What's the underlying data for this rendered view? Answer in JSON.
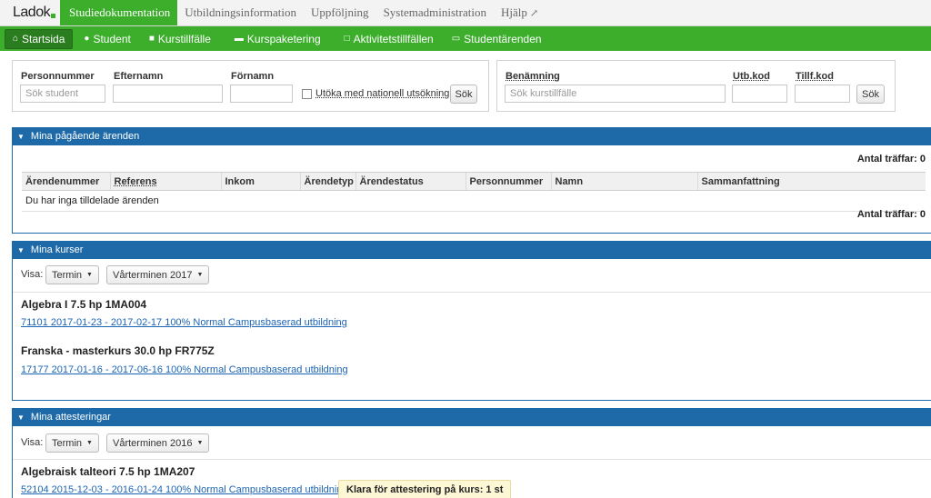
{
  "brand": {
    "logo": "Ladok",
    "accent": "#3cae2c",
    "section_blue": "#1e6aa8"
  },
  "topnav": {
    "tabs": [
      {
        "label": "Studiedokumentation"
      },
      {
        "label": "Utbildningsinformation"
      },
      {
        "label": "Uppföljning"
      },
      {
        "label": "Systemadministration"
      },
      {
        "label": "Hjälp",
        "icon": "external-link-icon"
      }
    ]
  },
  "subnav": {
    "items": [
      {
        "label": "Startsida",
        "icon": "home-icon"
      },
      {
        "label": "Student",
        "icon": "user-icon"
      },
      {
        "label": "Kurstillfälle",
        "icon": "book-icon"
      },
      {
        "label": "Kurspaketering",
        "icon": "folder-icon"
      },
      {
        "label": "Aktivitetstillfällen",
        "icon": "calendar-icon"
      },
      {
        "label": "Studentärenden",
        "icon": "inbox-icon"
      }
    ]
  },
  "student_search": {
    "personnummer_label": "Personnummer",
    "personnummer_placeholder": "Sök student",
    "efternamn_label": "Efternamn",
    "fornamn_label": "Förnamn",
    "national_checkbox_label": "Utöka med nationell utsökning",
    "search_button": "Sök"
  },
  "course_search": {
    "benamning_label": "Benämning",
    "benamning_placeholder": "Sök kurstillfälle",
    "utbkod_label": "Utb.kod",
    "tillfkod_label": "Tillf.kod",
    "search_button": "Sök"
  },
  "arenden": {
    "title": "Mina pågående ärenden",
    "count_top": "Antal träffar: 0",
    "count_bottom": "Antal träffar: 0",
    "columns": [
      "Ärendenummer",
      "Referens",
      "Inkom",
      "Ärendetyp",
      "Ärendestatus",
      "Personnummer",
      "Namn",
      "Sammanfattning"
    ],
    "empty_message": "Du har inga tilldelade ärenden"
  },
  "kurser": {
    "title": "Mina kurser",
    "visa_label": "Visa:",
    "filter_type": "Termin",
    "filter_term": "Vårterminen 2017",
    "courses": [
      {
        "title": "Algebra I 7.5 hp 1MA004",
        "link": "71101 2017-01-23 - 2017-02-17 100% Normal Campusbaserad utbildning"
      },
      {
        "title": "Franska - masterkurs 30.0 hp FR775Z",
        "link": "17177 2017-01-16 - 2017-06-16 100% Normal Campusbaserad utbildning"
      }
    ]
  },
  "attesteringar": {
    "title": "Mina attesteringar",
    "visa_label": "Visa:",
    "filter_type": "Termin",
    "filter_term": "Vårterminen 2016",
    "courses": [
      {
        "title": "Algebraisk talteori 7.5 hp 1MA207",
        "link": "52104 2015-12-03 - 2016-01-24 100% Normal Campusbaserad utbildning",
        "badge": "Klara för attestering på kurs: 1 st"
      }
    ]
  }
}
